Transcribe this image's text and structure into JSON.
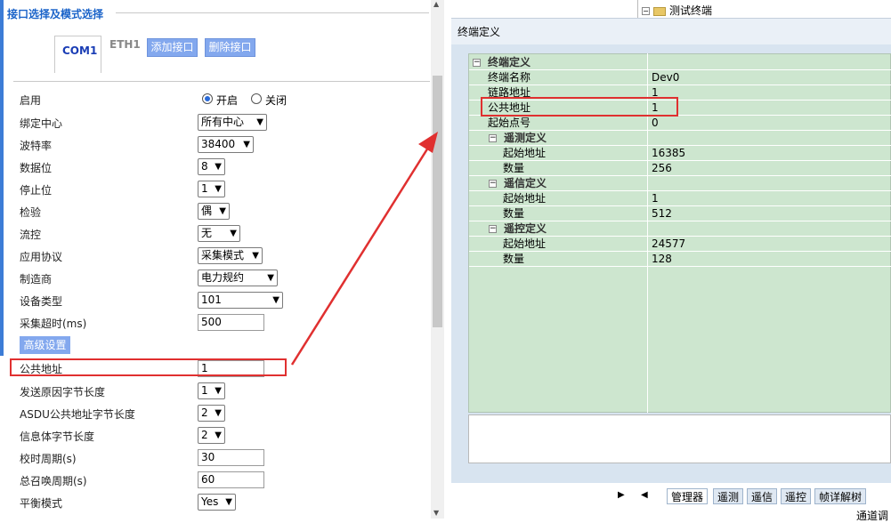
{
  "left": {
    "section_title": "接口选择及模式选择",
    "tabs": [
      "COM1",
      "ETH1"
    ],
    "add_button": "添加接口",
    "delete_button": "删除接口",
    "rows": [
      {
        "label": "启用",
        "kind": "radio",
        "options": [
          "开启",
          "关闭"
        ],
        "selected": "开启"
      },
      {
        "label": "绑定中心",
        "kind": "select",
        "value": "所有中心"
      },
      {
        "label": "波特率",
        "kind": "select",
        "value": "38400"
      },
      {
        "label": "数据位",
        "kind": "select",
        "value": "8"
      },
      {
        "label": "停止位",
        "kind": "select",
        "value": "1"
      },
      {
        "label": "检验",
        "kind": "select",
        "value": "偶"
      },
      {
        "label": "流控",
        "kind": "select",
        "value": "无"
      },
      {
        "label": "应用协议",
        "kind": "select",
        "value": "采集模式"
      },
      {
        "label": "制造商",
        "kind": "select",
        "value": "电力规约"
      },
      {
        "label": "设备类型",
        "kind": "select",
        "value": "101"
      },
      {
        "label": "采集超时(ms)",
        "kind": "input",
        "value": "500"
      },
      {
        "label": "公共地址",
        "kind": "input",
        "value": "1"
      },
      {
        "label": "发送原因字节长度",
        "kind": "select",
        "value": "1"
      },
      {
        "label": "ASDU公共地址字节长度",
        "kind": "select",
        "value": "2"
      },
      {
        "label": "信息体字节长度",
        "kind": "select",
        "value": "2"
      },
      {
        "label": "校时周期(s)",
        "kind": "input",
        "value": "30"
      },
      {
        "label": "总召唤周期(s)",
        "kind": "input",
        "value": "60"
      },
      {
        "label": "平衡模式",
        "kind": "select",
        "value": "Yes"
      }
    ],
    "advanced_button": "高级设置"
  },
  "right": {
    "tree_item": "测试终端",
    "window_title": "终端定义",
    "grid": [
      {
        "type": "group",
        "level": 0,
        "label": "终端定义"
      },
      {
        "type": "prop",
        "level": 1,
        "label": "终端名称",
        "value": "Dev0"
      },
      {
        "type": "prop",
        "level": 1,
        "label": "链路地址",
        "value": "1"
      },
      {
        "type": "prop",
        "level": 1,
        "label": "公共地址",
        "value": "1"
      },
      {
        "type": "prop",
        "level": 1,
        "label": "起始点号",
        "value": "0"
      },
      {
        "type": "group",
        "level": 1,
        "label": "遥测定义"
      },
      {
        "type": "prop",
        "level": 2,
        "label": "起始地址",
        "value": "16385"
      },
      {
        "type": "prop",
        "level": 2,
        "label": "数量",
        "value": "256"
      },
      {
        "type": "group",
        "level": 1,
        "label": "遥信定义"
      },
      {
        "type": "prop",
        "level": 2,
        "label": "起始地址",
        "value": "1"
      },
      {
        "type": "prop",
        "level": 2,
        "label": "数量",
        "value": "512"
      },
      {
        "type": "group",
        "level": 1,
        "label": "遥控定义"
      },
      {
        "type": "prop",
        "level": 2,
        "label": "起始地址",
        "value": "24577"
      },
      {
        "type": "prop",
        "level": 2,
        "label": "数量",
        "value": "128"
      }
    ],
    "bottom_tabs": [
      "管理器",
      "遥测",
      "遥信",
      "遥控",
      "帧详解树"
    ],
    "status_fragment": "通道调"
  },
  "colors": {
    "accent": "#1a63c9",
    "grid_bg": "#cde6cf",
    "highlight": "#e03030",
    "button_bg": "#83a8ee"
  }
}
